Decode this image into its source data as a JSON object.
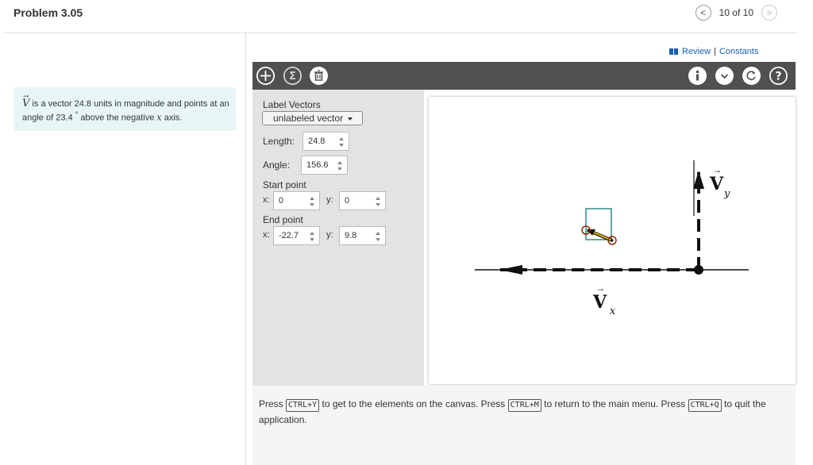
{
  "header": {
    "title": "Problem 3.05",
    "pager_text": "10 of 10",
    "prev_icon": "<",
    "next_icon": ">"
  },
  "prompt": {
    "vector_symbol": "V",
    "text_1": " is a vector 24.8 units in magnitude and points at an angle of 23.4 ",
    "degree": "°",
    "text_2": " above the negative ",
    "axis": "x",
    "text_3": " axis."
  },
  "links": {
    "review": "Review",
    "separator": "|",
    "constants": "Constants"
  },
  "toolbar": {
    "add_icon": "+",
    "sum_icon": "Σ",
    "delete_icon": "trash-icon",
    "info_icon": "i",
    "menu_icon": "⌄",
    "reset_icon": "↻",
    "help_icon": "?"
  },
  "panel": {
    "label_vectors_title": "Label Vectors",
    "label_vectors_value": "unlabeled vector",
    "length_label": "Length:",
    "length_value": "24.8",
    "angle_label": "Angle:",
    "angle_value": "156.6",
    "start_title": "Start point",
    "start_x_label": "x:",
    "start_x_value": "0",
    "start_y_label": "y:",
    "start_y_value": "0",
    "end_title": "End point",
    "end_x_label": "x:",
    "end_x_value": "-22.7",
    "end_y_label": "y:",
    "end_y_value": "9.8"
  },
  "canvas": {
    "vy_label": "V",
    "vy_sub": "y",
    "vx_label": "V",
    "vx_sub": "x"
  },
  "footer": {
    "press_1": "Press",
    "key_1": "CTRL+Y",
    "text_1": "to get to the elements on the canvas. Press",
    "key_2": "CTRL+M",
    "text_2": "to return to the main menu. Press",
    "key_3": "CTRL+Q",
    "text_3": "to quit the application."
  },
  "colors": {
    "toolbar_bg": "#505050",
    "panel_bg": "#e3e3e3",
    "prompt_bg": "#e8f5f7",
    "link": "#1a5fb4",
    "vector_handle": "#e6b800",
    "selection_box": "#2e8b8b"
  }
}
